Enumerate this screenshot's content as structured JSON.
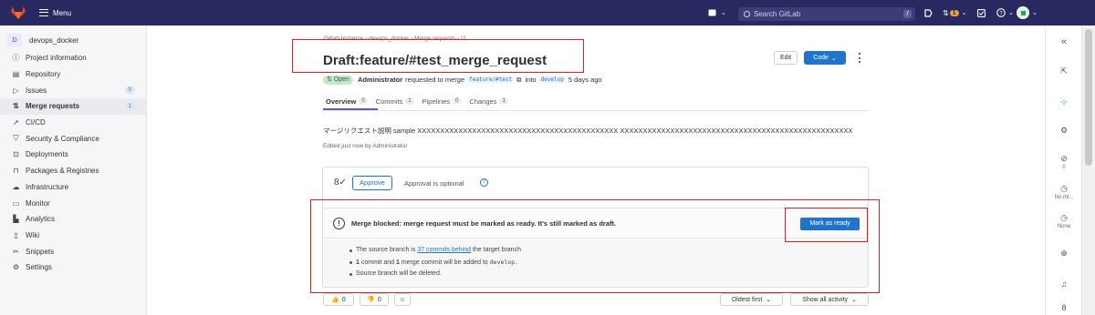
{
  "topbar": {
    "menu_label": "Menu",
    "search_placeholder": "Search GitLab",
    "search_shortcut": "/",
    "mr_count": "1"
  },
  "sidebar": {
    "project_initial": "D",
    "project_name": "devops_docker",
    "items": [
      {
        "label": "Project information",
        "icon": "info-icon"
      },
      {
        "label": "Repository",
        "icon": "repository-icon"
      },
      {
        "label": "Issues",
        "icon": "issues-icon",
        "count": "0"
      },
      {
        "label": "Merge requests",
        "icon": "merge-request-icon",
        "count": "1",
        "active": true
      },
      {
        "label": "CI/CD",
        "icon": "rocket-icon"
      },
      {
        "label": "Security & Compliance",
        "icon": "shield-icon"
      },
      {
        "label": "Deployments",
        "icon": "deployments-icon"
      },
      {
        "label": "Packages & Registries",
        "icon": "package-icon"
      },
      {
        "label": "Infrastructure",
        "icon": "cloud-icon"
      },
      {
        "label": "Monitor",
        "icon": "monitor-icon"
      },
      {
        "label": "Analytics",
        "icon": "chart-icon"
      },
      {
        "label": "Wiki",
        "icon": "book-icon"
      },
      {
        "label": "Snippets",
        "icon": "snippet-icon"
      },
      {
        "label": "Settings",
        "icon": "gear-icon"
      }
    ]
  },
  "breadcrumb": {
    "b1": "Gitlab Instance",
    "b2": "devops_docker",
    "b3": "Merge requests",
    "b4": "!2",
    "sep": "›"
  },
  "mr": {
    "title": "Draft:feature/#test_merge_request",
    "edit_label": "Edit",
    "code_label": "Code",
    "status": "Open",
    "author": "Administrator",
    "requested_text": "requested to merge",
    "source_branch": "feature/#test",
    "into_text": "into",
    "target_branch": "develop",
    "time": "5 days ago"
  },
  "tabs": [
    {
      "label": "Overview",
      "count": "0"
    },
    {
      "label": "Commits",
      "count": "1"
    },
    {
      "label": "Pipelines",
      "count": "0"
    },
    {
      "label": "Changes",
      "count": "1"
    }
  ],
  "description": "マージリクエスト説明 sample XXXXXXXXXXXXXXXXXXXXXXXXXXXXXXXXXXXXXXXXXXXX XXXXXXXXXXXXXXXXXXXXXXXXXXXXXXXXXXXXXXXXXXXXXXXXXXX",
  "edited": "Edited just now by Administrator",
  "approval": {
    "approve_label": "Approve",
    "optional_text": "Approval is optional"
  },
  "merge": {
    "blocked_text": "Merge blocked: merge request must be marked as ready. It's still marked as draft.",
    "ready_label": "Mark as ready",
    "b1_pre": "The source branch is",
    "b1_link": "37 commits behind",
    "b1_post": "the target branch",
    "b2_n1": "1",
    "b2_mid": "commit and",
    "b2_n2": "1",
    "b2_post": "merge commit will be added to",
    "b2_branch": "develop.",
    "b3": "Source branch will be deleted."
  },
  "reactions": {
    "thumbs_up": "0",
    "thumbs_down": "0"
  },
  "sort": {
    "order": "Oldest first",
    "filter": "Show all activity"
  },
  "right_sidebar": {
    "labels_count": "0",
    "milestone": "No mi...",
    "time_tracking": "None"
  },
  "colors": {
    "topbar": "#292961",
    "primary": "#1f75cb",
    "annotation_red": "#e02020"
  }
}
